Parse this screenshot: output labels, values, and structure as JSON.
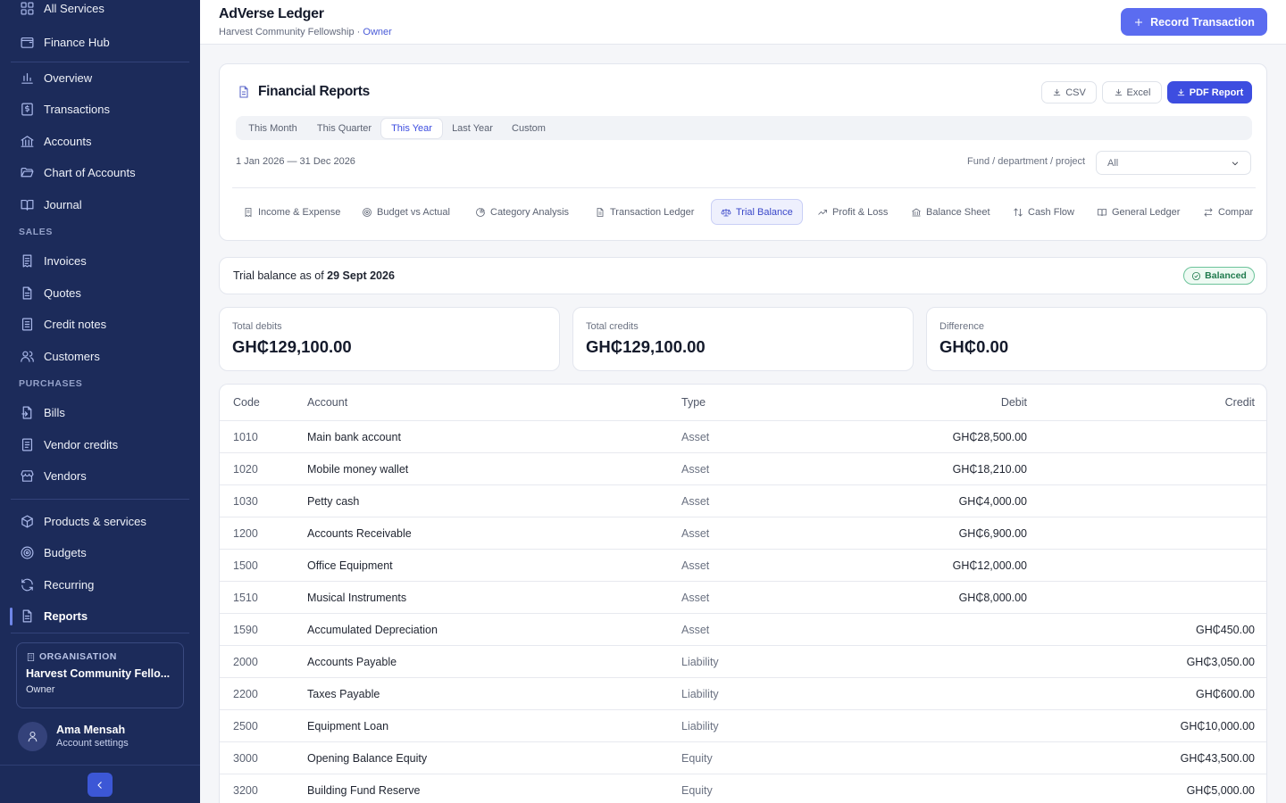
{
  "sidebar": {
    "items": [
      {
        "label": "All Services",
        "icon": "grid-icon"
      },
      {
        "label": "Finance Hub",
        "icon": "wallet-icon"
      },
      {
        "label": "Overview",
        "icon": "bar-chart-icon"
      },
      {
        "label": "Transactions",
        "icon": "receipt-dollar-icon"
      },
      {
        "label": "Accounts",
        "icon": "bank-icon"
      },
      {
        "label": "Chart of Accounts",
        "icon": "folder-open-icon"
      },
      {
        "label": "Journal",
        "icon": "book-open-icon"
      },
      {
        "label": "Invoices",
        "icon": "invoice-icon"
      },
      {
        "label": "Quotes",
        "icon": "file-text-icon"
      },
      {
        "label": "Credit notes",
        "icon": "note-icon"
      },
      {
        "label": "Customers",
        "icon": "users-icon"
      },
      {
        "label": "Bills",
        "icon": "file-import-icon"
      },
      {
        "label": "Vendor credits",
        "icon": "credit-note-icon"
      },
      {
        "label": "Vendors",
        "icon": "store-icon"
      },
      {
        "label": "Products & services",
        "icon": "box-icon"
      },
      {
        "label": "Budgets",
        "icon": "target-icon"
      },
      {
        "label": "Recurring",
        "icon": "refresh-icon"
      },
      {
        "label": "Reports",
        "icon": "report-icon"
      }
    ],
    "sections": {
      "sales": "SALES",
      "purchases": "PURCHASES"
    },
    "org": {
      "label": "ORGANISATION",
      "name": "Harvest Community Fello...",
      "role": "Owner"
    },
    "user": {
      "name": "Ama Mensah",
      "sub": "Account settings"
    }
  },
  "header": {
    "title": "AdVerse Ledger",
    "org": "Harvest Community Fellowship",
    "separator": " · ",
    "role": "Owner",
    "record_button": "Record Transaction"
  },
  "reports": {
    "title": "Financial Reports",
    "export": {
      "csv": "CSV",
      "excel": "Excel",
      "pdf": "PDF Report"
    },
    "periods": [
      "This Month",
      "This Quarter",
      "This Year",
      "Last Year",
      "Custom"
    ],
    "active_period": "This Year",
    "date_range": "1 Jan 2026 — 31 Dec 2026",
    "filter_label": "Fund / department / project",
    "filter_value": "All",
    "tabs": [
      "Income & Expense",
      "Budget vs Actual",
      "Category Analysis",
      "Transaction Ledger",
      "Trial Balance",
      "Profit & Loss",
      "Balance Sheet",
      "Cash Flow",
      "General Ledger",
      "Compar"
    ],
    "active_tab": "Trial Balance"
  },
  "trial_balance": {
    "prefix": "Trial balance as of ",
    "date": "29 Sept 2026",
    "status": "Balanced",
    "stats": {
      "debits_label": "Total debits",
      "debits_value": "GH₵129,100.00",
      "credits_label": "Total credits",
      "credits_value": "GH₵129,100.00",
      "diff_label": "Difference",
      "diff_value": "GH₵0.00"
    },
    "columns": {
      "code": "Code",
      "account": "Account",
      "type": "Type",
      "debit": "Debit",
      "credit": "Credit"
    },
    "rows": [
      {
        "code": "1010",
        "account": "Main bank account",
        "type": "Asset",
        "debit": "GH₵28,500.00",
        "credit": ""
      },
      {
        "code": "1020",
        "account": "Mobile money wallet",
        "type": "Asset",
        "debit": "GH₵18,210.00",
        "credit": ""
      },
      {
        "code": "1030",
        "account": "Petty cash",
        "type": "Asset",
        "debit": "GH₵4,000.00",
        "credit": ""
      },
      {
        "code": "1200",
        "account": "Accounts Receivable",
        "type": "Asset",
        "debit": "GH₵6,900.00",
        "credit": ""
      },
      {
        "code": "1500",
        "account": "Office Equipment",
        "type": "Asset",
        "debit": "GH₵12,000.00",
        "credit": ""
      },
      {
        "code": "1510",
        "account": "Musical Instruments",
        "type": "Asset",
        "debit": "GH₵8,000.00",
        "credit": ""
      },
      {
        "code": "1590",
        "account": "Accumulated Depreciation",
        "type": "Asset",
        "debit": "",
        "credit": "GH₵450.00"
      },
      {
        "code": "2000",
        "account": "Accounts Payable",
        "type": "Liability",
        "debit": "",
        "credit": "GH₵3,050.00"
      },
      {
        "code": "2200",
        "account": "Taxes Payable",
        "type": "Liability",
        "debit": "",
        "credit": "GH₵600.00"
      },
      {
        "code": "2500",
        "account": "Equipment Loan",
        "type": "Liability",
        "debit": "",
        "credit": "GH₵10,000.00"
      },
      {
        "code": "3000",
        "account": "Opening Balance Equity",
        "type": "Equity",
        "debit": "",
        "credit": "GH₵43,500.00"
      },
      {
        "code": "3200",
        "account": "Building Fund Reserve",
        "type": "Equity",
        "debit": "",
        "credit": "GH₵5,000.00"
      }
    ]
  },
  "colors": {
    "sidebar": "#1c2b5a",
    "accent": "#5b6cf0",
    "primary": "#3d4de0",
    "success": "#1f7a4d"
  }
}
